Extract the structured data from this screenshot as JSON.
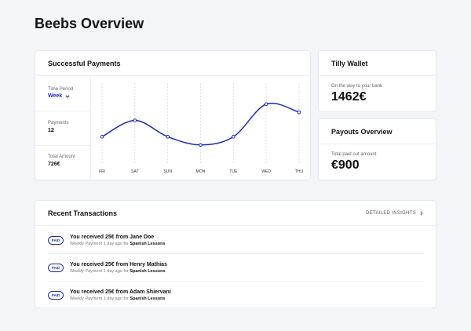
{
  "page": {
    "title": "Beebs Overview"
  },
  "payments": {
    "title": "Successful Payments",
    "period_label": "Time Period",
    "period_value": "Week",
    "count_label": "Payments",
    "count_value": "12",
    "total_label": "Total Amount",
    "total_value": "726€"
  },
  "chart_data": {
    "type": "line",
    "categories": [
      "FRI",
      "SAT",
      "SUN",
      "MON",
      "TUE",
      "WED",
      "THU"
    ],
    "values": [
      2.4,
      3.8,
      2.4,
      1.7,
      2.4,
      5.2,
      4.5
    ],
    "ylim": [
      0,
      7
    ],
    "grid": true,
    "line_color": "#1c2bb5"
  },
  "wallet": {
    "title": "Tilly Wallet",
    "label": "On the way to your bank",
    "value": "1462€"
  },
  "payouts": {
    "title": "Payouts Overview",
    "label": "Total paid out amount",
    "value": "€900"
  },
  "transactions": {
    "title": "Recent Transactions",
    "link_label": "DETAILED INSIGHTS",
    "items": [
      {
        "badge": "PAID",
        "title": "You received 25€ from Jane Doe",
        "sub_prefix": "Weekly Payment 1 day ago for",
        "sub_course": "Spanish Lessons"
      },
      {
        "badge": "PAID",
        "title": "You received 25€ from Henry Mathias",
        "sub_prefix": "Weekly Payment 1 day ago for",
        "sub_course": "Spanish Lessons"
      },
      {
        "badge": "PAID",
        "title": "You received 25€ from Adam Shiervani",
        "sub_prefix": "Weekly Payment 1 day ago for",
        "sub_course": "Spanish Lessons"
      }
    ]
  }
}
